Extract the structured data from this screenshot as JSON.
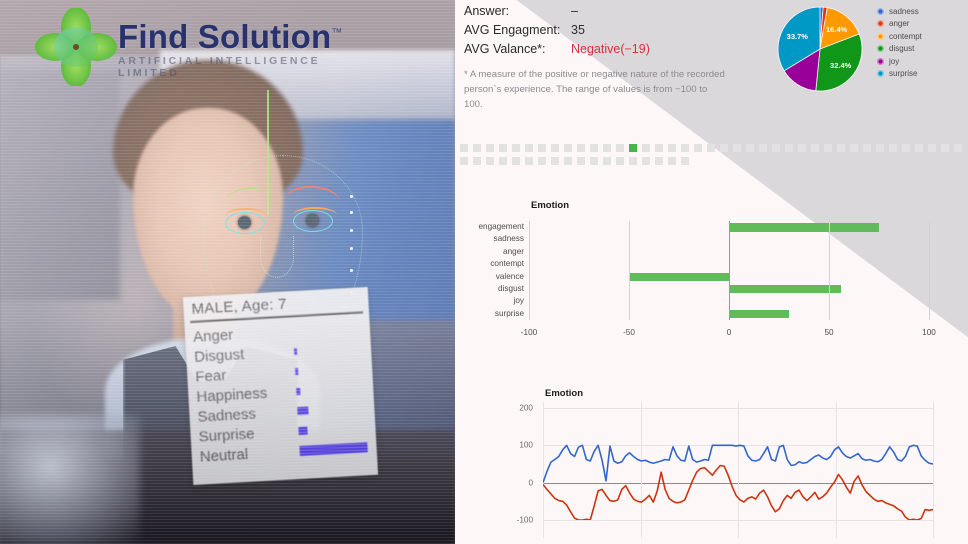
{
  "brand": {
    "title": "Find Solution",
    "tm": "™",
    "tagline": "ARTIFICIAL INTELLIGENCE LIMITED",
    "mark": "four-petal-flower-logo"
  },
  "video_overlay": {
    "subject_header": "MALE, Age: 7",
    "emotions": [
      {
        "label": "Anger",
        "value": 0
      },
      {
        "label": "Disgust",
        "value": 2
      },
      {
        "label": "Fear",
        "value": 2
      },
      {
        "label": "Happiness",
        "value": 3
      },
      {
        "label": "Sadness",
        "value": 11
      },
      {
        "label": "Surprise",
        "value": 9
      },
      {
        "label": "Neutral",
        "value": 62
      }
    ],
    "bar_color": "#3a23e8"
  },
  "stats": {
    "rows": [
      {
        "label": "Answer:",
        "value": "–",
        "negative": false
      },
      {
        "label": "AVG Engagment:",
        "value": "35",
        "negative": false
      },
      {
        "label": "AVG Valance*:",
        "value": "Negative(−19)",
        "negative": true
      }
    ],
    "footnote": "* A measure of the positive or negative nature of the recorded person`s experience. The range of values is from −100 to 100.",
    "negative_color": "#d0333b"
  },
  "timeline": {
    "total_cells": 57,
    "active_index": 13,
    "cells_row1": 40,
    "active_color": "#43b649",
    "inactive_color": "#e2e2e2"
  },
  "chart_data": [
    {
      "type": "pie",
      "title": "",
      "labels": [
        "sadness",
        "anger",
        "contempt",
        "disgust",
        "joy",
        "surprise"
      ],
      "values": [
        1.2,
        1.6,
        16.4,
        32.4,
        14.7,
        33.7
      ],
      "value_labels": [
        "",
        "",
        "16.4%",
        "32.4%",
        "",
        "33.7%"
      ],
      "colors": [
        "#3366cc",
        "#dc3912",
        "#ff9900",
        "#109618",
        "#990099",
        "#0099c6"
      ],
      "legend": "right"
    },
    {
      "type": "bar",
      "title": "Emotion",
      "orientation": "horizontal",
      "categories": [
        "engagement",
        "sadness",
        "anger",
        "contempt",
        "valence",
        "disgust",
        "joy",
        "surprise"
      ],
      "values": [
        75,
        0,
        0,
        0,
        -50,
        56,
        0,
        30
      ],
      "xlim": [
        -100,
        100
      ],
      "xticks": [
        -100,
        -50,
        0,
        50,
        100
      ],
      "xtick_labels": [
        "-100",
        "-50",
        "0",
        "50",
        "100"
      ],
      "xlabel": "",
      "ylabel": "",
      "bar_color": "#62bb5b",
      "grid": true
    },
    {
      "type": "line",
      "title": "Emotion",
      "ylim": [
        -100,
        200
      ],
      "yticks": [
        200,
        100,
        0,
        -100
      ],
      "ytick_labels": [
        "200",
        "100",
        "0",
        "-100"
      ],
      "xlabel": "",
      "ylabel": "",
      "grid": true,
      "series": [
        {
          "name": "engagement",
          "color": "#3366cc",
          "values": [
            0,
            30,
            55,
            62,
            70,
            88,
            100,
            78,
            70,
            95,
            100,
            62,
            58,
            84,
            100,
            60,
            5,
            98,
            58,
            52,
            56,
            72,
            80,
            70,
            62,
            58,
            60,
            55,
            52,
            55,
            58,
            62,
            60,
            96,
            72,
            60,
            58,
            98,
            62,
            55,
            58,
            62,
            60,
            100,
            100,
            100,
            100,
            100,
            100,
            98,
            100,
            98,
            72,
            60,
            58,
            62,
            78,
            96,
            62,
            58,
            96,
            100,
            62,
            46,
            48,
            56,
            52,
            54,
            62,
            70,
            74,
            66,
            62,
            70,
            88,
            96,
            80,
            70,
            66,
            72,
            78,
            64,
            60,
            62,
            58,
            56,
            62,
            78,
            96,
            82,
            62,
            58,
            70,
            96,
            100,
            98,
            72,
            60,
            52,
            50
          ]
        },
        {
          "name": "valence",
          "color": "#cc3311",
          "values": [
            -5,
            -18,
            -30,
            -42,
            -48,
            -50,
            -60,
            -78,
            -95,
            -100,
            -100,
            -98,
            -100,
            -62,
            -22,
            -18,
            -34,
            -48,
            -50,
            -46,
            -18,
            -8,
            -28,
            -44,
            -50,
            -52,
            -44,
            -34,
            -52,
            -22,
            28,
            -18,
            -42,
            -50,
            -54,
            -52,
            -46,
            -20,
            6,
            28,
            38,
            40,
            30,
            20,
            34,
            46,
            44,
            20,
            -10,
            -34,
            -46,
            -52,
            -42,
            -38,
            -44,
            -28,
            -20,
            -38,
            -62,
            -78,
            -70,
            -48,
            -34,
            -42,
            -26,
            -20,
            -38,
            -48,
            -38,
            -26,
            -44,
            -38,
            -28,
            -12,
            2,
            22,
            8,
            -12,
            -28,
            4,
            18,
            -6,
            -24,
            -34,
            -44,
            -50,
            -48,
            -54,
            -58,
            -62,
            -70,
            -76,
            -92,
            -100,
            -98,
            -100,
            -96,
            -72,
            -74,
            -72
          ]
        }
      ]
    }
  ]
}
